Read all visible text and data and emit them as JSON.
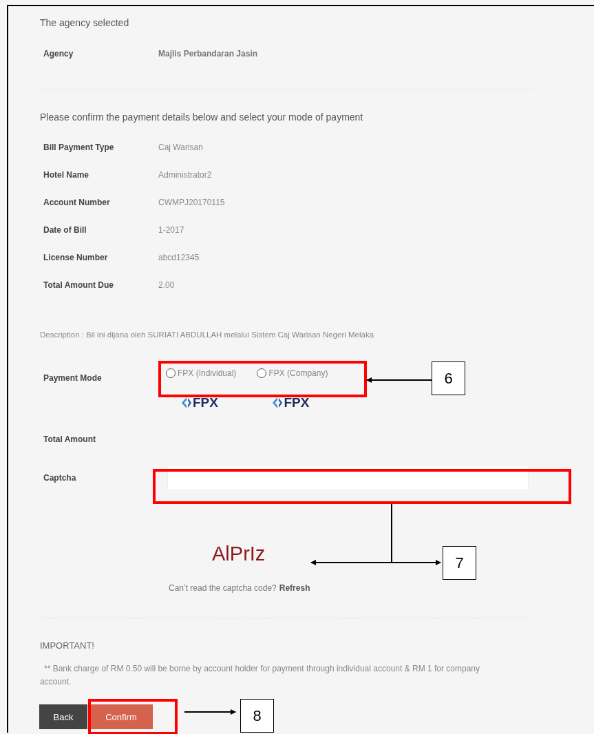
{
  "agency_section": {
    "heading": "The agency selected",
    "rows": [
      {
        "label": "Agency",
        "value": "Majlis Perbandaran Jasin",
        "emphasis": true
      }
    ]
  },
  "payment_section": {
    "heading": "Please confirm the payment details below and select your mode of payment",
    "rows": [
      {
        "label": "Bill Payment Type",
        "value": "Caj Warisan"
      },
      {
        "label": "Hotel Name",
        "value": "Administrator2"
      },
      {
        "label": "Account Number",
        "value": "CWMPJ20170115"
      },
      {
        "label": "Date of Bill",
        "value": "1-2017"
      },
      {
        "label": "License Number",
        "value": "abcd12345"
      },
      {
        "label": "Total Amount Due",
        "value": "2.00"
      }
    ]
  },
  "description": "Description : Bil ini dijana oleh SURIATI ABDULLAH melalui Sistem Caj Warisan Negeri Melaka",
  "payment_mode": {
    "label": "Payment Mode",
    "options": [
      {
        "label": "FPX (Individual)",
        "logo": "FPX",
        "selected": false
      },
      {
        "label": "FPX (Company)",
        "logo": "FPX",
        "selected": false
      }
    ]
  },
  "total_amount": {
    "label": "Total Amount"
  },
  "captcha": {
    "label": "Captcha",
    "code": "AlPrIz",
    "hint": "Can’t read the captcha code?",
    "refresh": "Refresh"
  },
  "important": {
    "heading": "IMPORTANT!",
    "note": "** Bank charge of RM 0.50 will be borne by account holder for payment through individual account & RM 1 for company account."
  },
  "buttons": [
    {
      "label": "Back",
      "kind": "secondary"
    },
    {
      "label": "Confirm",
      "kind": "primary"
    }
  ],
  "annotations": [
    {
      "number": "6",
      "kind": "single"
    },
    {
      "number": "7",
      "kind": "split"
    },
    {
      "number": "8",
      "kind": "single"
    }
  ]
}
